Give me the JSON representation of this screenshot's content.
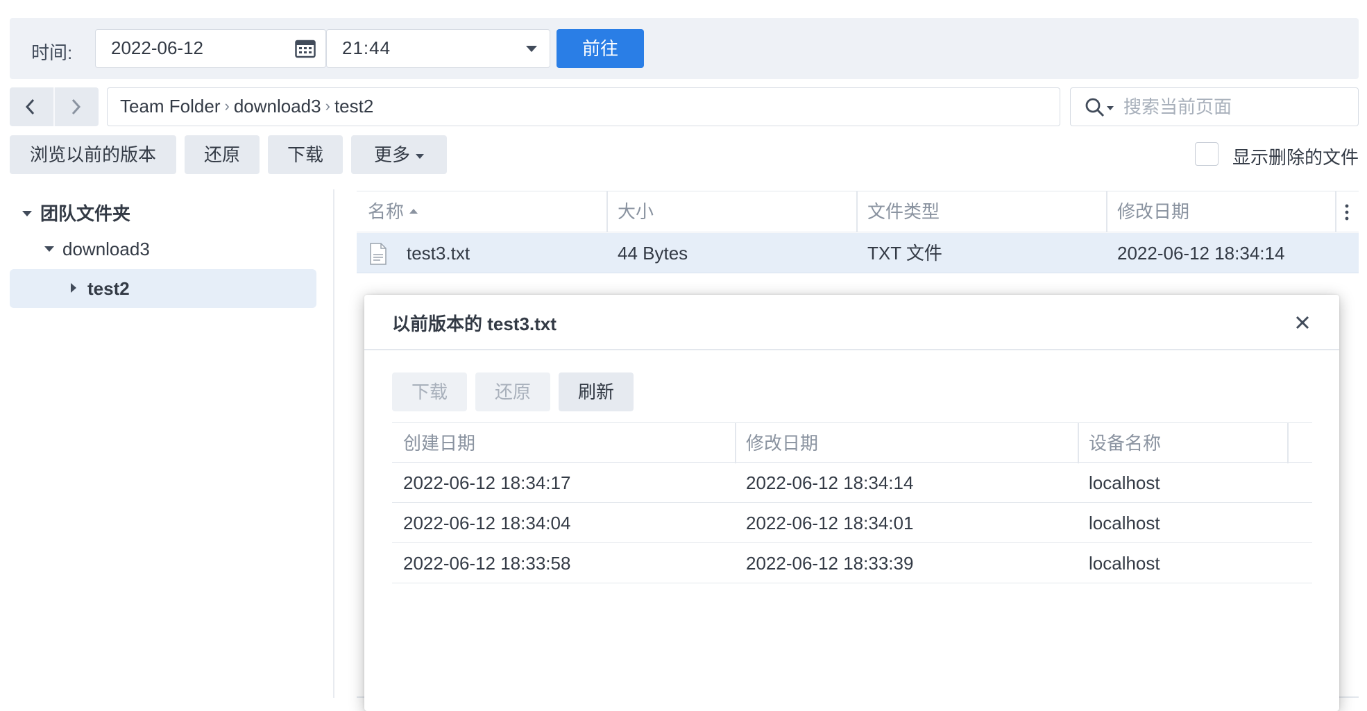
{
  "timebar": {
    "label": "时间:",
    "date": "2022-06-12",
    "time": "21:44",
    "go_label": "前往",
    "accent": "#2a7ee6"
  },
  "breadcrumb": [
    "Team Folder",
    "download3",
    "test2"
  ],
  "search": {
    "placeholder": "搜索当前页面"
  },
  "toolbar": {
    "browse_versions": "浏览以前的版本",
    "restore": "还原",
    "download": "下载",
    "more": "更多",
    "show_deleted": "显示删除的文件"
  },
  "tree": {
    "root": "团队文件夹",
    "child": "download3",
    "selected": "test2"
  },
  "file_table": {
    "columns": [
      "名称",
      "大小",
      "文件类型",
      "修改日期"
    ],
    "rows": [
      {
        "name": "test3.txt",
        "size": "44 Bytes",
        "type": "TXT 文件",
        "modified": "2022-06-12 18:34:14"
      }
    ]
  },
  "dialog": {
    "title": "以前版本的 test3.txt",
    "buttons": {
      "download": "下载",
      "restore": "还原",
      "refresh": "刷新"
    },
    "columns": [
      "创建日期",
      "修改日期",
      "设备名称"
    ],
    "rows": [
      [
        "2022-06-12 18:34:17",
        "2022-06-12 18:34:14",
        "localhost"
      ],
      [
        "2022-06-12 18:34:04",
        "2022-06-12 18:34:01",
        "localhost"
      ],
      [
        "2022-06-12 18:33:58",
        "2022-06-12 18:33:39",
        "localhost"
      ]
    ]
  },
  "icons": {
    "calendar": "calendar-icon",
    "search": "search-icon",
    "back": "chevron-left-icon",
    "forward": "chevron-right-icon",
    "close": "close-icon",
    "file": "text-file-icon",
    "column_menu": "vertical-dots-icon"
  }
}
